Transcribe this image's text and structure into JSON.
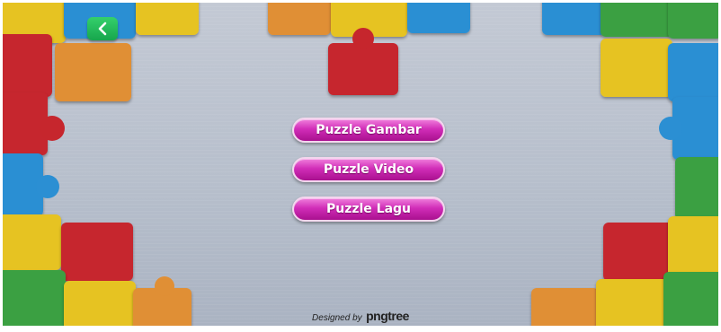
{
  "menu": {
    "items": [
      {
        "label": "Puzzle Gambar"
      },
      {
        "label": "Puzzle Video"
      },
      {
        "label": "Puzzle Lagu"
      }
    ]
  },
  "navigation": {
    "back_icon": "chevron-left-icon"
  },
  "footer": {
    "designed_by": "Designed by",
    "brand": "pngtree"
  },
  "colors": {
    "accent_magenta": "#d12db8",
    "back_green": "#17a64c",
    "puzzle_red": "#c6262d",
    "puzzle_yellow": "#e6c321",
    "puzzle_blue": "#2b8fd3",
    "puzzle_green": "#3aa043",
    "puzzle_orange": "#e08f35"
  }
}
